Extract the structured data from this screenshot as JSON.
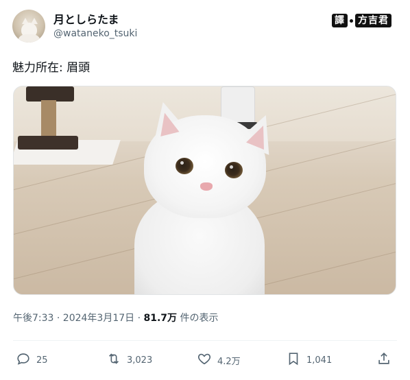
{
  "header": {
    "display_name": "月としらたま",
    "handle": "@wataneko_tsuki"
  },
  "watermark": {
    "part1": "譯",
    "part2": "方吉君"
  },
  "tweet": {
    "text": "魅力所在: 眉頭",
    "timestamp": "午後7:33 · 2024年3月17日 · ",
    "views_count": "81.7万",
    "views_label": " 件の表示"
  },
  "actions": {
    "replies": "25",
    "retweets": "3,023",
    "likes": "4.2万",
    "bookmarks": "1,041"
  },
  "icons": [
    "reply-icon",
    "retweet-icon",
    "like-icon",
    "bookmark-icon",
    "share-icon"
  ]
}
